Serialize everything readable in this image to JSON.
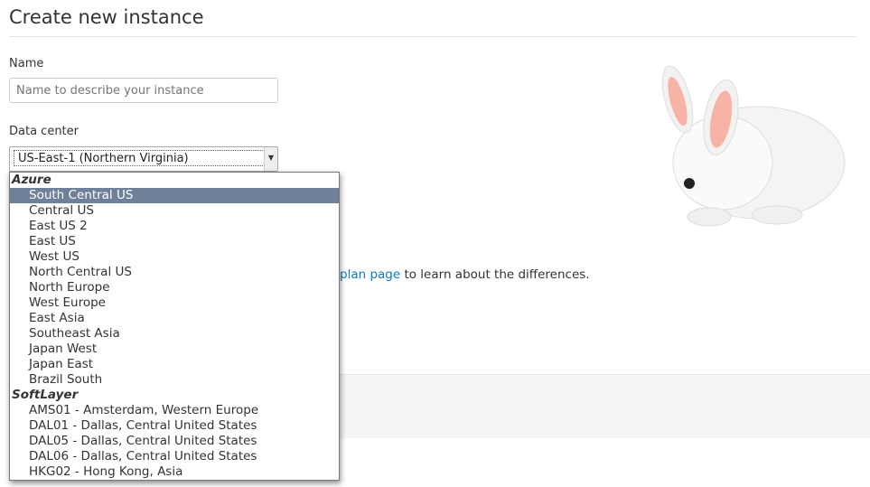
{
  "page": {
    "title": "Create new instance"
  },
  "name_field": {
    "label": "Name",
    "placeholder": "Name to describe your instance"
  },
  "data_center": {
    "label": "Data center",
    "selected": "US-East-1 (Northern Virginia)"
  },
  "help": {
    "link_text": "plan page",
    "rest": " to learn about the differences."
  },
  "dropdown": {
    "groups": [
      {
        "label": "Azure",
        "options": [
          "South Central US",
          "Central US",
          "East US 2",
          "East US",
          "West US",
          "North Central US",
          "North Europe",
          "West Europe",
          "East Asia",
          "Southeast Asia",
          "Japan West",
          "Japan East",
          "Brazil South"
        ]
      },
      {
        "label": "SoftLayer",
        "options": [
          "AMS01 - Amsterdam, Western Europe",
          "DAL01 - Dallas, Central United States",
          "DAL05 - Dallas, Central United States",
          "DAL06 - Dallas, Central United States",
          "HKG02 - Hong Kong, Asia"
        ]
      }
    ],
    "highlighted": "South Central US",
    "highlight_color": "#6e8199"
  }
}
